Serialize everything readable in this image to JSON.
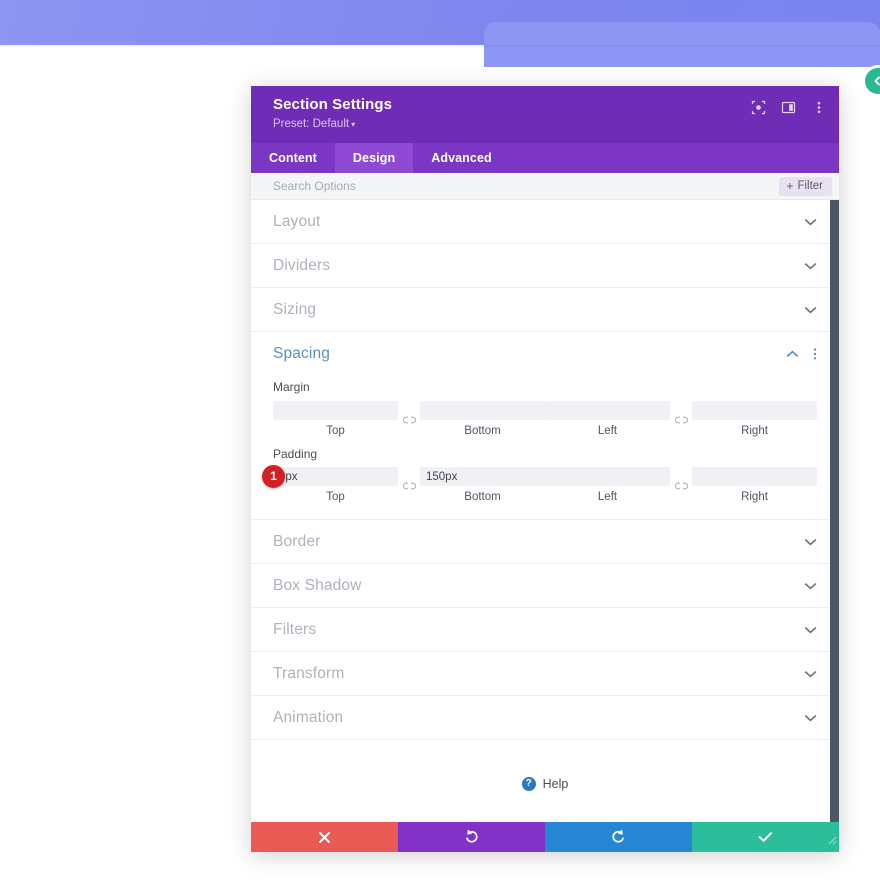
{
  "background": {
    "hero_color": "#8d95f5",
    "float_button": {
      "icon": "chevron-left-icon",
      "color": "#2db894"
    }
  },
  "modal": {
    "title": "Section Settings",
    "preset": "Preset: Default",
    "preset_caret": "▾",
    "header_icons": [
      {
        "name": "responsive-view-icon"
      },
      {
        "name": "layout-panel-icon"
      },
      {
        "name": "more-options-icon"
      }
    ],
    "tabs": [
      {
        "label": "Content",
        "active": false
      },
      {
        "label": "Design",
        "active": true
      },
      {
        "label": "Advanced",
        "active": false
      }
    ],
    "search": {
      "placeholder": "Search Options",
      "value": "",
      "filter_label": "Filter",
      "filter_plus": "+"
    },
    "sections_before": [
      {
        "label": "Layout"
      },
      {
        "label": "Dividers"
      },
      {
        "label": "Sizing"
      }
    ],
    "spacing": {
      "title": "Spacing",
      "accent_color": "#5a8fc0",
      "margin": {
        "label": "Margin",
        "fields": [
          {
            "sub": "Top",
            "value": "",
            "placeholder": ""
          },
          {
            "sub": "Bottom",
            "value": "",
            "placeholder": ""
          },
          {
            "sub": "Left",
            "value": "",
            "placeholder": ""
          },
          {
            "sub": "Right",
            "value": "",
            "placeholder": ""
          }
        ]
      },
      "padding": {
        "label": "Padding",
        "badge": "1",
        "badge_color": "#d32027",
        "fields": [
          {
            "sub": "Top",
            "value": "0px",
            "placeholder": ""
          },
          {
            "sub": "Bottom",
            "value": "150px",
            "placeholder": ""
          },
          {
            "sub": "Left",
            "value": "",
            "placeholder": ""
          },
          {
            "sub": "Right",
            "value": "",
            "placeholder": ""
          }
        ]
      }
    },
    "sections_after": [
      {
        "label": "Border"
      },
      {
        "label": "Box Shadow"
      },
      {
        "label": "Filters"
      },
      {
        "label": "Transform"
      },
      {
        "label": "Animation"
      }
    ],
    "help": {
      "label": "Help",
      "icon_char": "?"
    },
    "footer": [
      {
        "name": "cancel",
        "icon": "close-icon",
        "color": "#ea5a54"
      },
      {
        "name": "undo",
        "icon": "undo-icon",
        "color": "#8332c9"
      },
      {
        "name": "redo",
        "icon": "redo-icon",
        "color": "#2686d4"
      },
      {
        "name": "save",
        "icon": "check-icon",
        "color": "#2cbd9b"
      }
    ]
  }
}
